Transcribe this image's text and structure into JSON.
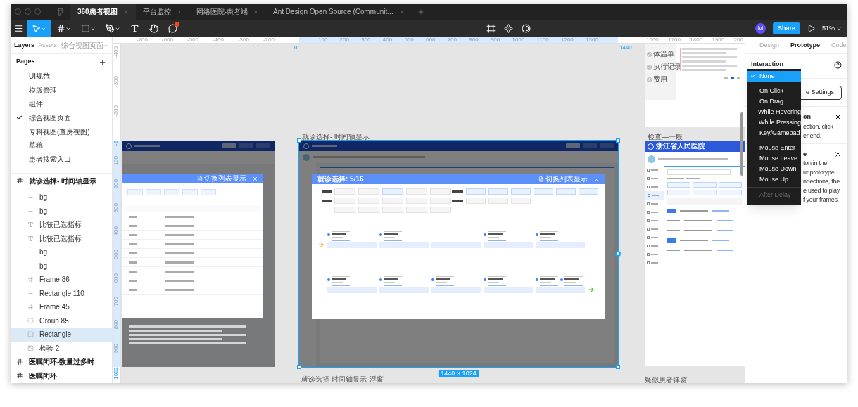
{
  "tabs": [
    {
      "label": "360患者视图",
      "selected": true
    },
    {
      "label": "平台监控",
      "selected": false
    },
    {
      "label": "网络医院-患者端",
      "selected": false
    },
    {
      "label": "Ant Design Open Source (Communit...",
      "selected": false
    }
  ],
  "toolbar": {
    "tools": [
      {
        "kind": "move",
        "selected": true,
        "caret": true
      },
      {
        "kind": "frame",
        "selected": false,
        "caret": true
      },
      {
        "kind": "rect",
        "selected": false,
        "caret": true
      },
      {
        "kind": "pen",
        "selected": false,
        "caret": true
      },
      {
        "kind": "text",
        "selected": false,
        "caret": false
      },
      {
        "kind": "hand",
        "selected": false,
        "caret": false
      },
      {
        "kind": "comment",
        "selected": false,
        "caret": false,
        "notification": true
      }
    ],
    "center_tools": [
      {
        "kind": "frame-corners"
      },
      {
        "kind": "component"
      },
      {
        "kind": "contrast"
      }
    ],
    "avatar": "M",
    "share": "Share",
    "zoom": "51%"
  },
  "layers_panel": {
    "tabs": [
      {
        "label": "Layers",
        "selected": true
      },
      {
        "label": "Assets",
        "selected": false
      }
    ],
    "page_menu": "综合视图页面",
    "pages_title": "Pages",
    "pages": [
      {
        "label": "UI规范",
        "selected": false
      },
      {
        "label": "模版管理",
        "selected": false
      },
      {
        "label": "组件",
        "selected": false
      },
      {
        "label": "综合视图页面",
        "selected": true
      },
      {
        "label": "专科视图(查房视图)",
        "selected": false
      },
      {
        "label": "草稿",
        "selected": false
      },
      {
        "label": "患者搜索入口",
        "selected": false
      }
    ],
    "layers": [
      {
        "label": "就诊选择- 时间轴显示",
        "kind": "frame",
        "selected": false,
        "children": [
          {
            "label": "bg",
            "kind": "line",
            "selected": false
          },
          {
            "label": "bg",
            "kind": "line",
            "selected": false
          },
          {
            "label": "比较已选指标",
            "kind": "text",
            "selected": false
          },
          {
            "label": "比较已选指标",
            "kind": "text",
            "selected": false
          },
          {
            "label": "bg",
            "kind": "line",
            "selected": false
          },
          {
            "label": "bg",
            "kind": "line",
            "selected": false
          },
          {
            "label": "Frame 86",
            "kind": "frame",
            "selected": false
          },
          {
            "label": "Rectangle 110",
            "kind": "line",
            "selected": false
          },
          {
            "label": "Frame 45",
            "kind": "frame",
            "selected": false
          },
          {
            "label": "Group 85",
            "kind": "group",
            "selected": false
          },
          {
            "label": "Rectangle",
            "kind": "rect",
            "selected": true
          },
          {
            "label": "检验 2",
            "kind": "image",
            "selected": false
          }
        ]
      },
      {
        "label": "医嘱闭环-数量过多时",
        "kind": "frame",
        "selected": false
      },
      {
        "label": "医嘱闭环",
        "kind": "frame",
        "selected": false
      }
    ]
  },
  "canvas": {
    "ruler_top": {
      "before": [
        "-700",
        "-600",
        "-500",
        "-400",
        "-300",
        "-200"
      ],
      "start": "0",
      "inside": [
        "100",
        "200",
        "300",
        "400",
        "500",
        "600",
        "700",
        "800",
        "900",
        "1000",
        "1100",
        "1200",
        "1300"
      ],
      "end": "1440",
      "after": [
        "1600",
        "1700",
        "1800",
        "1900",
        "200"
      ]
    },
    "ruler_left": {
      "before": [
        "-400",
        "-300",
        "-200"
      ],
      "start": "-2",
      "inside": [
        "100",
        "200",
        "300",
        "400",
        "500",
        "600",
        "700",
        "800",
        "900"
      ],
      "end": "1022"
    },
    "frames": [
      {
        "kind": "list_dialog",
        "switch": "切换列表显示"
      },
      {
        "kind": "timeline",
        "label": "就诊选择- 时间轴显示",
        "selected": true,
        "size": "1440 × 1024",
        "dialog_title": "就诊选择: 5/16",
        "switch": "切换列表显示"
      },
      {
        "kind": "stub",
        "label": "就诊选择-时间轴显示-浮窗"
      },
      {
        "kind": "nav_panel",
        "items": [
          "体温单",
          "执行记录",
          "费用"
        ]
      },
      {
        "kind": "exam",
        "label": "检查—一般",
        "hospital": "浙江省人民医院"
      },
      {
        "kind": "stub",
        "label": "疑似患者弹窗"
      }
    ]
  },
  "right_panel": {
    "tabs": [
      {
        "label": "Design",
        "selected": false
      },
      {
        "label": "Prototype",
        "selected": true
      },
      {
        "label": "Code",
        "selected": false
      }
    ],
    "section_title": "Interaction",
    "settings_button": "e Settings",
    "sections": [
      {
        "title": "on",
        "lines": [
          "ection, click",
          "er end."
        ]
      },
      {
        "title": "e",
        "lines": [
          "ton in the",
          "ur prototype.",
          "nnections, the",
          "e used to play",
          "f your frames."
        ]
      }
    ],
    "dropdown": [
      {
        "items": [
          {
            "label": "None",
            "selected": true,
            "disabled": false
          }
        ]
      },
      {
        "items": [
          {
            "label": "On Click",
            "selected": false,
            "disabled": false
          },
          {
            "label": "On Drag",
            "selected": false,
            "disabled": false
          },
          {
            "label": "While Hovering",
            "selected": false,
            "disabled": false
          },
          {
            "label": "While Pressing",
            "selected": false,
            "disabled": false
          },
          {
            "label": "Key/Gamepad",
            "selected": false,
            "disabled": false
          }
        ]
      },
      {
        "items": [
          {
            "label": "Mouse Enter",
            "selected": false,
            "disabled": false
          },
          {
            "label": "Mouse Leave",
            "selected": false,
            "disabled": false
          },
          {
            "label": "Mouse Down",
            "selected": false,
            "disabled": false
          },
          {
            "label": "Mouse Up",
            "selected": false,
            "disabled": false
          }
        ]
      },
      {
        "items": [
          {
            "label": "After Delay",
            "selected": false,
            "disabled": true
          }
        ]
      }
    ]
  }
}
